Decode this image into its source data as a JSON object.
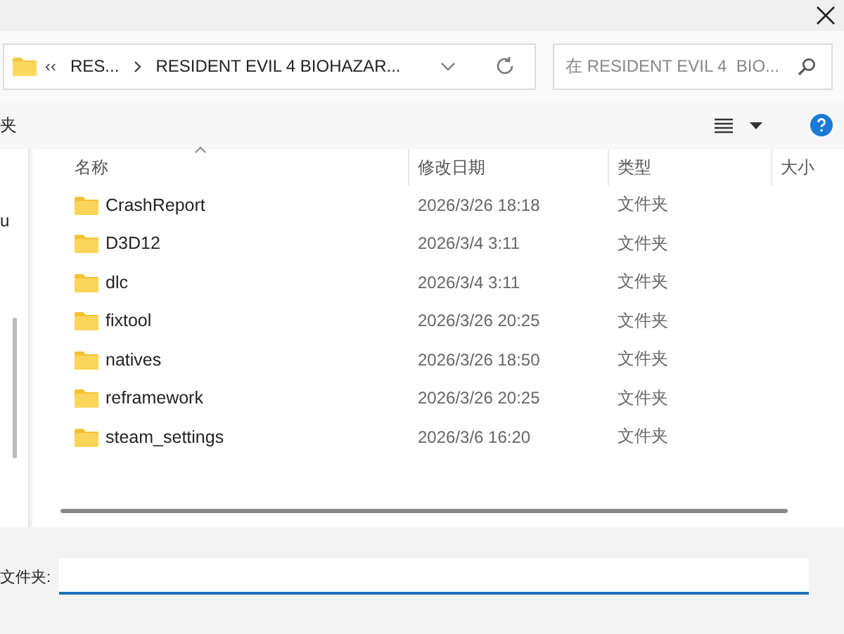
{
  "address_bar": {
    "overflow": "‹‹",
    "crumbs": [
      "RES...",
      "RESIDENT EVIL 4  BIOHAZAR..."
    ]
  },
  "search": {
    "placeholder": "在 RESIDENT EVIL 4  BIO..."
  },
  "toolbar": {
    "cut_label": "夹"
  },
  "nav_pane": {
    "cut_label": "u"
  },
  "columns": [
    {
      "label": "名称",
      "sorted": true
    },
    {
      "label": "修改日期",
      "sorted": false
    },
    {
      "label": "类型",
      "sorted": false
    },
    {
      "label": "大小",
      "sorted": false
    }
  ],
  "rows": [
    {
      "name": "CrashReport",
      "date": "2026/3/26 18:18",
      "type": "文件夹"
    },
    {
      "name": "D3D12",
      "date": "2026/3/4 3:11",
      "type": "文件夹"
    },
    {
      "name": "dlc",
      "date": "2026/3/4 3:11",
      "type": "文件夹"
    },
    {
      "name": "fixtool",
      "date": "2026/3/26 20:25",
      "type": "文件夹"
    },
    {
      "name": "natives",
      "date": "2026/3/26 18:50",
      "type": "文件夹"
    },
    {
      "name": "reframework",
      "date": "2026/3/26 20:25",
      "type": "文件夹"
    },
    {
      "name": "steam_settings",
      "date": "2026/3/6 16:20",
      "type": "文件夹"
    }
  ],
  "folder_field": {
    "label": "文件夹:"
  }
}
